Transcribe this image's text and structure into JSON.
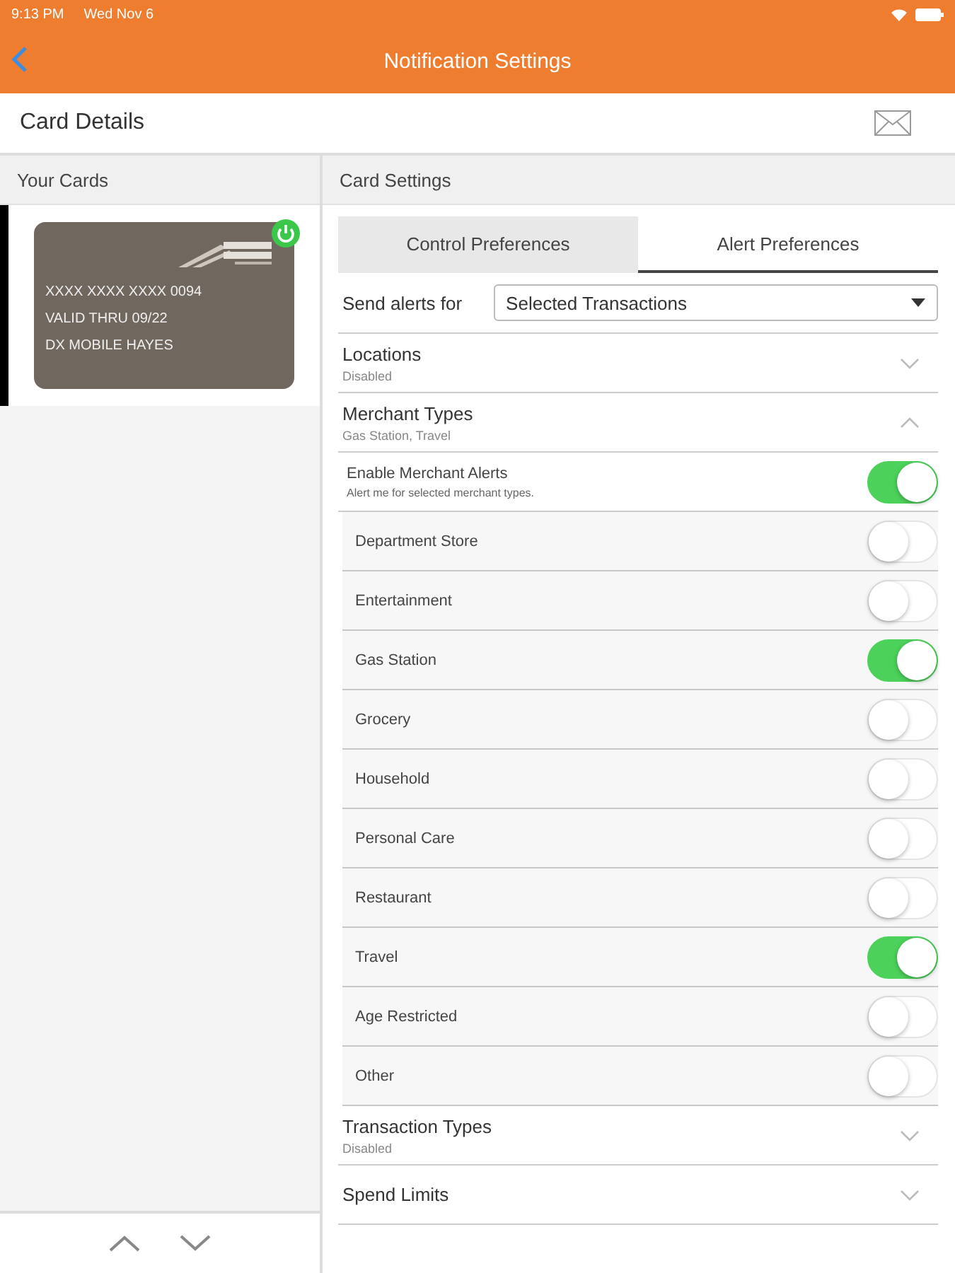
{
  "status_bar": {
    "time": "9:13 PM",
    "date": "Wed Nov 6"
  },
  "nav": {
    "title": "Notification Settings"
  },
  "header": {
    "title": "Card Details"
  },
  "cards_panel": {
    "title": "Your Cards",
    "cards": [
      {
        "number": "XXXX XXXX XXXX 0094",
        "valid": "VALID THRU 09/22",
        "name": "DX MOBILE HAYES",
        "on": true,
        "selected": true
      }
    ]
  },
  "settings_panel": {
    "title": "Card Settings",
    "tabs": [
      {
        "label": "Control Preferences",
        "selected": false
      },
      {
        "label": "Alert Preferences",
        "selected": true
      }
    ],
    "send_alerts": {
      "label": "Send alerts for",
      "value": "Selected Transactions"
    },
    "rows": [
      {
        "kind": "section",
        "title": "Locations",
        "subtitle": "Disabled",
        "expanded": false
      },
      {
        "kind": "section",
        "title": "Merchant Types",
        "subtitle": "Gas Station, Travel",
        "expanded": true
      },
      {
        "kind": "master",
        "title": "Enable Merchant Alerts",
        "subtitle": "Alert me for selected merchant types.",
        "on": true
      },
      {
        "kind": "toggle",
        "title": "Department Store",
        "on": false
      },
      {
        "kind": "toggle",
        "title": "Entertainment",
        "on": false
      },
      {
        "kind": "toggle",
        "title": "Gas Station",
        "on": true
      },
      {
        "kind": "toggle",
        "title": "Grocery",
        "on": false
      },
      {
        "kind": "toggle",
        "title": "Household",
        "on": false
      },
      {
        "kind": "toggle",
        "title": "Personal Care",
        "on": false
      },
      {
        "kind": "toggle",
        "title": "Restaurant",
        "on": false
      },
      {
        "kind": "toggle",
        "title": "Travel",
        "on": true
      },
      {
        "kind": "toggle",
        "title": "Age Restricted",
        "on": false
      },
      {
        "kind": "toggle",
        "title": "Other",
        "on": false
      },
      {
        "kind": "section",
        "title": "Transaction Types",
        "subtitle": "Disabled",
        "expanded": false
      },
      {
        "kind": "section",
        "title": "Spend Limits",
        "expanded": false
      }
    ]
  }
}
